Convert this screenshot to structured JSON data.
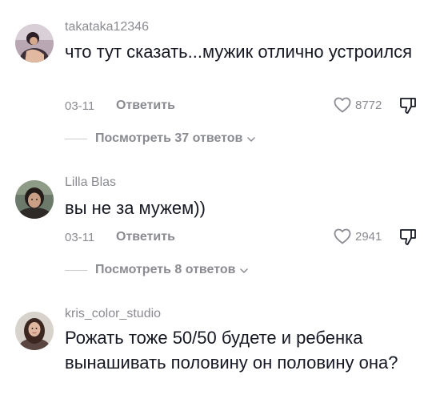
{
  "comments": [
    {
      "username": "takataka12346",
      "text": "что тут сказать...мужик отлично устроился",
      "date": "03-11",
      "reply_label": "Ответить",
      "likes": "8772",
      "view_replies": "Посмотреть 37 ответов",
      "avatar_icon": "user-avatar"
    },
    {
      "username": "Lilla Blas",
      "text": "вы не за мужем))",
      "date": "03-11",
      "reply_label": "Ответить",
      "likes": "2941",
      "view_replies": "Посмотреть 8 ответов",
      "avatar_icon": "user-avatar"
    },
    {
      "username": "kris_color_studio",
      "text": "Рожать тоже 50/50 будете и ребенка вынашивать половину он половину она?",
      "avatar_icon": "user-avatar"
    }
  ],
  "icons": {
    "like": "heart-outline-icon",
    "dislike": "thumbs-down-icon",
    "expand": "chevron-down-icon"
  },
  "colors": {
    "text": "#161823",
    "secondary": "#8a8b91",
    "divider": "#c9cacd"
  }
}
